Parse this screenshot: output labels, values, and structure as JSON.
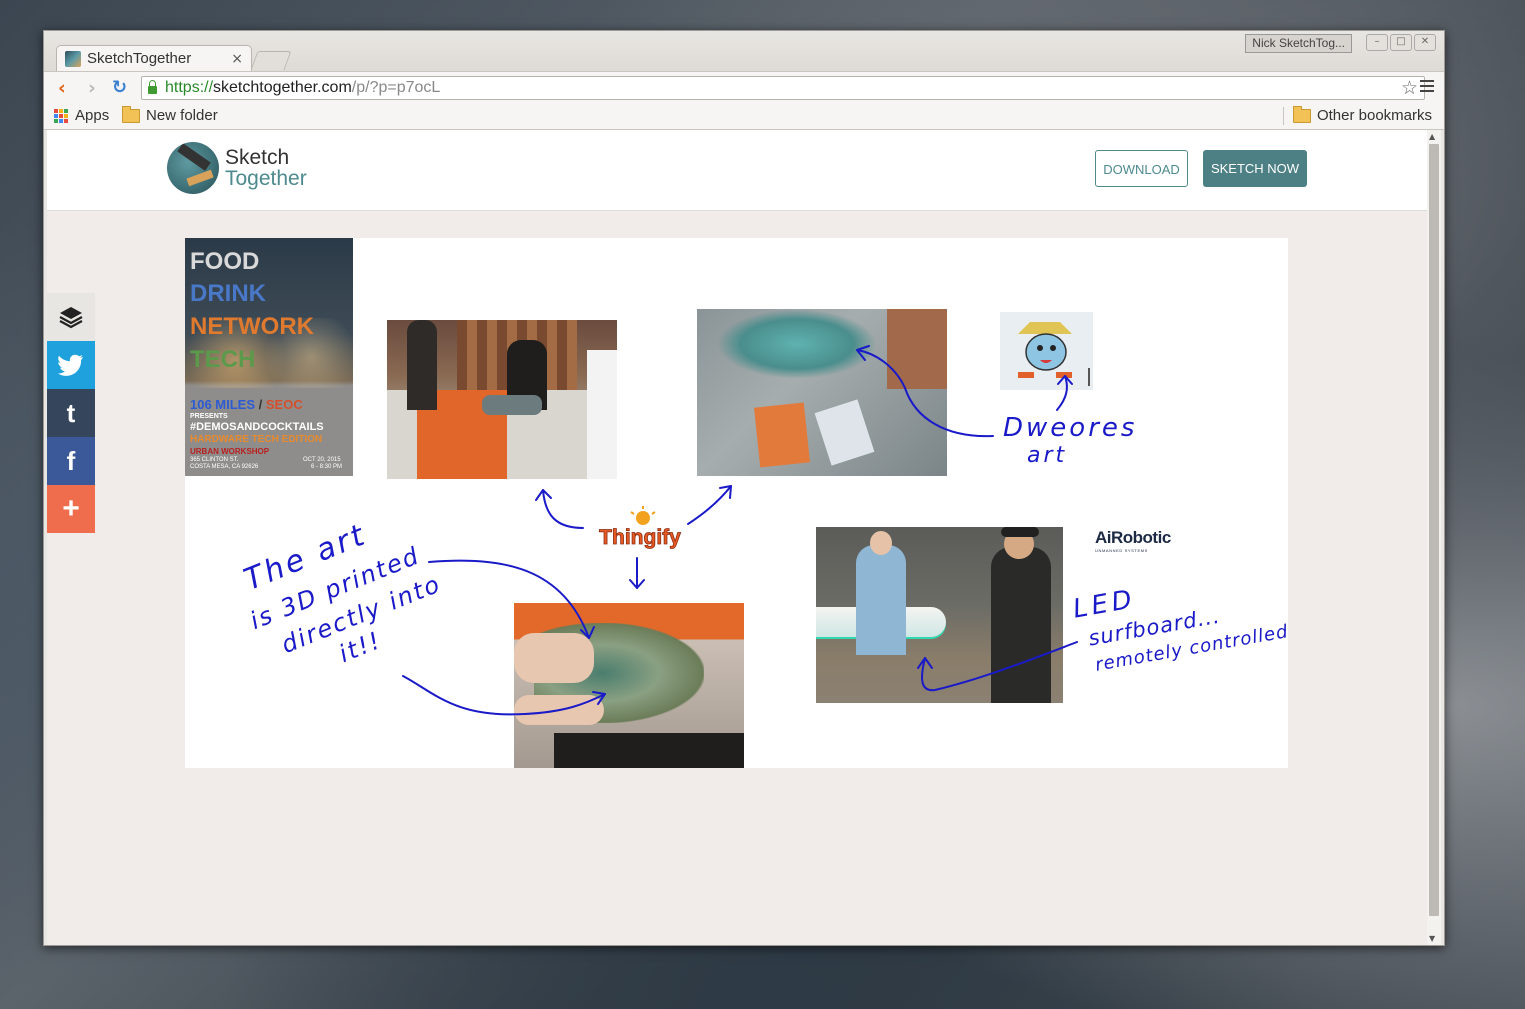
{
  "browser": {
    "tab_title": "SketchTogether",
    "tab_close": "×",
    "profile_name": "Nick SketchTog...",
    "url_scheme": "https://",
    "url_host": "sketchtogether.com",
    "url_path": "/p/?p=p7ocL",
    "bookmarks": [
      {
        "label": "Apps"
      },
      {
        "label": "New folder"
      }
    ],
    "other_bookmarks": "Other bookmarks"
  },
  "site": {
    "logo_line1": "Sketch",
    "logo_line2": "Together",
    "download_label": "DOWNLOAD",
    "sketch_now_label": "SKETCH NOW"
  },
  "share_bar": {
    "items": [
      {
        "icon": "layers-icon",
        "color": "#e8e6e3"
      },
      {
        "icon": "twitter-icon",
        "color": "#1ea1dc"
      },
      {
        "icon": "tumblr-icon",
        "color": "#35465c",
        "glyph": "t"
      },
      {
        "icon": "facebook-icon",
        "color": "#3b5998",
        "glyph": "f"
      },
      {
        "icon": "plus-icon",
        "color": "#ef6c4d",
        "glyph": "+"
      }
    ]
  },
  "sketch": {
    "poster": {
      "line1": "FOOD",
      "line2": "DRINK",
      "line3": "NETWORK",
      "line4": "TECH",
      "miles": "106 MILES",
      "slash": " / ",
      "seoc": "SEOC",
      "presents": "PRESENTS",
      "hashtag": "#DEMOSANDCOCKTAILS",
      "edition": "HARDWARE TECH EDITION",
      "venue": "URBAN WORKSHOP",
      "address1": "365 CLINTON ST.",
      "address2": "COSTA MESA, CA 92626",
      "date": "OCT 20, 2015",
      "time": "6 - 8:30 PM"
    },
    "thingify_logo": "Thingify",
    "airobotic_logo": "AiRobotic",
    "airobotic_sub": "UNMANNED SYSTEMS",
    "note_dweores_1": "Dweores",
    "note_dweores_2": "art",
    "note_art_1": "The art",
    "note_art_2": "is 3D printed",
    "note_art_3": "directly into",
    "note_art_4": "it!!",
    "note_led_1": "LED",
    "note_led_2": "surfboard...",
    "note_led_3": "remotely controlled!"
  },
  "colors": {
    "accent": "#4d8085",
    "ink": "#1a1ac8"
  }
}
